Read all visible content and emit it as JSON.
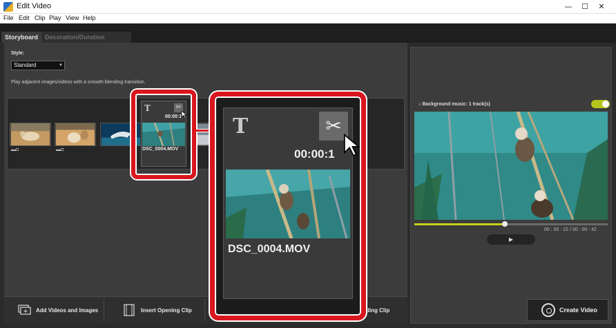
{
  "window": {
    "title": "Edit Video",
    "minimize": "—",
    "maximize": "☐",
    "close": "✕"
  },
  "menu": [
    "File",
    "Edit",
    "Clip",
    "Play",
    "View",
    "Help"
  ],
  "tabs": {
    "active": "Storyboard",
    "inactive": "Decoration/Duration Settings"
  },
  "style": {
    "label": "Style:",
    "value": "Standard",
    "description": "Play adjacent images/videos with a smooth blending transition."
  },
  "clip": {
    "title_icon": "T",
    "duration": "00:00:1",
    "duration_small": "00:00:1",
    "filename": "DSC_0004.MOV"
  },
  "bottom_buttons": {
    "add": "Add Videos and Images",
    "opening": "Insert Opening Clip",
    "ending": "ding Clip"
  },
  "preview": {
    "bgm_label": "Background music: 1 track(s)",
    "timecode": "00 : 00 : 22  /  00 : 00 : 42",
    "play": "▶",
    "progress": 0.47
  },
  "create": {
    "label": "Create Video"
  },
  "icons": {
    "scissors": "scissors-icon",
    "music": "music-note-icon",
    "camera": "camera-icon",
    "film": "film-icon"
  },
  "colors": {
    "highlight": "#d9161e",
    "accent": "#c6d41c",
    "background": "#2b2b2b"
  }
}
